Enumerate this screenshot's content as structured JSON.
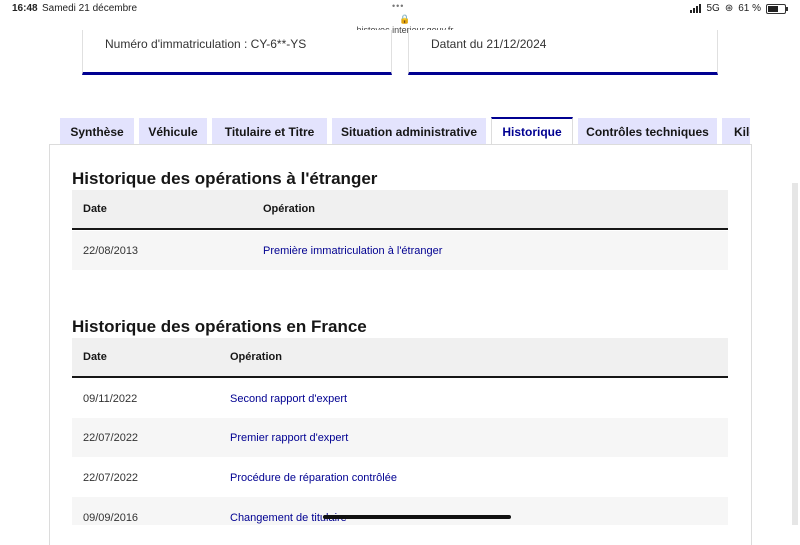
{
  "status_bar": {
    "time": "16:48",
    "date": "Samedi 21 décembre",
    "url": "histovec.interieur.gouv.fr",
    "network": "5G",
    "battery": "61 %",
    "battery_level": 61
  },
  "cards": [
    {
      "text": "Numéro d'immatriculation : CY-6**-YS"
    },
    {
      "text": "Datant du 21/12/2024"
    }
  ],
  "tabs": [
    {
      "label": "Synthèse",
      "active": false
    },
    {
      "label": "Véhicule",
      "active": false
    },
    {
      "label": "Titulaire et Titre",
      "active": false
    },
    {
      "label": "Situation administrative",
      "active": false
    },
    {
      "label": "Historique",
      "active": true
    },
    {
      "label": "Contrôles techniques",
      "active": false
    },
    {
      "label": "Kilo",
      "active": false
    }
  ],
  "sections": {
    "etranger": {
      "title": "Historique des opérations à l'étranger",
      "columns": [
        "Date",
        "Opération"
      ],
      "rows": [
        {
          "date": "22/08/2013",
          "operation": "Première immatriculation à l'étranger"
        }
      ]
    },
    "france": {
      "title": "Historique des opérations en France",
      "columns": [
        "Date",
        "Opération"
      ],
      "rows": [
        {
          "date": "09/11/2022",
          "operation": "Second rapport d'expert"
        },
        {
          "date": "22/07/2022",
          "operation": "Premier rapport d'expert"
        },
        {
          "date": "22/07/2022",
          "operation": "Procédure de réparation contrôlée"
        },
        {
          "date": "09/09/2016",
          "operation": "Changement de titulaire"
        }
      ]
    }
  },
  "colors": {
    "accent": "#000091",
    "tab_background": "#e3e3fd",
    "header_background": "#f0f0f0"
  }
}
